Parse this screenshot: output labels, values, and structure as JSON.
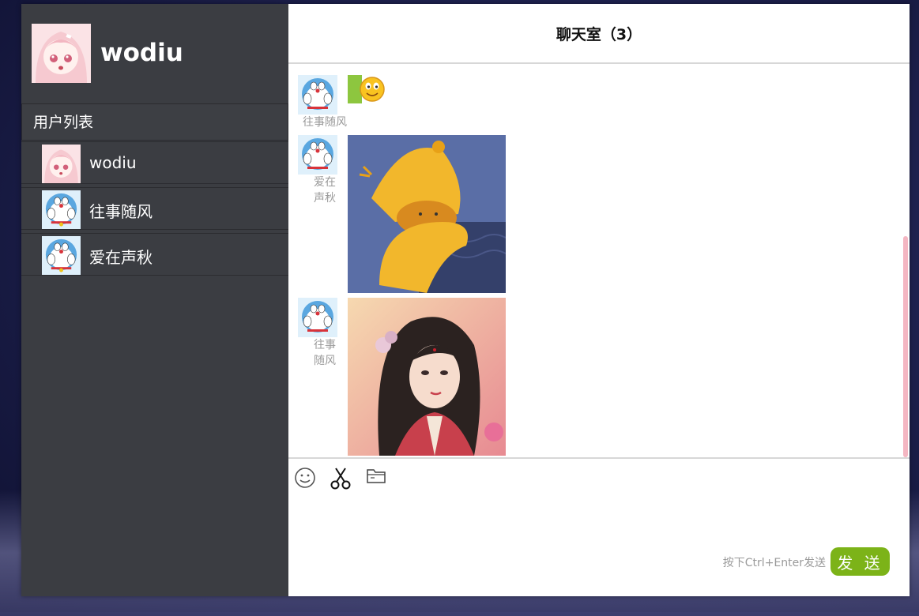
{
  "current_user": {
    "name": "wodiu"
  },
  "sidebar": {
    "list_title": "用户列表",
    "users": [
      {
        "name": "wodiu"
      },
      {
        "name": "往事随风"
      },
      {
        "name": "爱在声秋"
      }
    ]
  },
  "chat": {
    "title": "聊天室（3）",
    "messages": [
      {
        "sender_line1": "往事随风",
        "sender_line2": "",
        "content_type": "emoji"
      },
      {
        "sender_line1": "爱在",
        "sender_line2": "声秋",
        "content_type": "image"
      },
      {
        "sender_line1": "往事",
        "sender_line2": "随风",
        "content_type": "image"
      }
    ]
  },
  "composer": {
    "tools": [
      "smile-icon",
      "scissors-icon",
      "folder-icon"
    ],
    "hint": "按下Ctrl+Enter发送",
    "send_label": "发 送"
  },
  "colors": {
    "sidebar": "#3b3d42",
    "send": "#7cb318",
    "scrollbar": "#f4b6c2"
  }
}
